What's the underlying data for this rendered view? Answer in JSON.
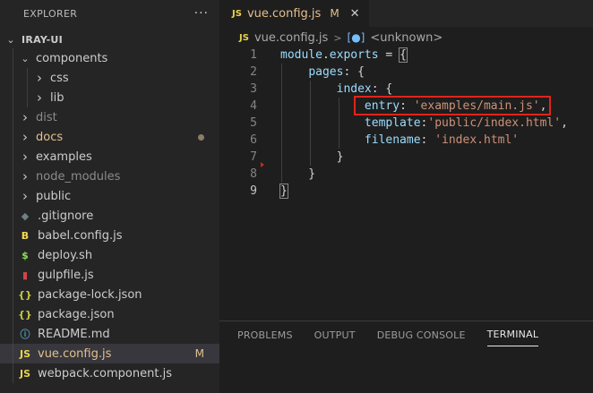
{
  "explorer": {
    "title": "EXPLORER",
    "more": "···",
    "root": "IRAY-UI",
    "items": [
      {
        "name": "components",
        "type": "folder",
        "open": true,
        "indent": 1,
        "style": "normal"
      },
      {
        "name": "css",
        "type": "folder",
        "open": false,
        "indent": 2,
        "style": "normal"
      },
      {
        "name": "lib",
        "type": "folder",
        "open": false,
        "indent": 2,
        "style": "normal"
      },
      {
        "name": "dist",
        "type": "folder",
        "open": false,
        "indent": 1,
        "style": "dim"
      },
      {
        "name": "docs",
        "type": "folder",
        "open": false,
        "indent": 1,
        "style": "mod",
        "dot": true
      },
      {
        "name": "examples",
        "type": "folder",
        "open": false,
        "indent": 1,
        "style": "normal"
      },
      {
        "name": "node_modules",
        "type": "folder",
        "open": false,
        "indent": 1,
        "style": "dim"
      },
      {
        "name": "public",
        "type": "folder",
        "open": false,
        "indent": 1,
        "style": "normal"
      },
      {
        "name": ".gitignore",
        "type": "file",
        "icon": "gitignore",
        "indent": 1,
        "style": "normal"
      },
      {
        "name": "babel.config.js",
        "type": "file",
        "icon": "babel",
        "indent": 1,
        "style": "normal"
      },
      {
        "name": "deploy.sh",
        "type": "file",
        "icon": "shell",
        "indent": 1,
        "style": "normal"
      },
      {
        "name": "gulpfile.js",
        "type": "file",
        "icon": "gulp",
        "indent": 1,
        "style": "normal"
      },
      {
        "name": "package-lock.json",
        "type": "file",
        "icon": "json",
        "indent": 1,
        "style": "normal"
      },
      {
        "name": "package.json",
        "type": "file",
        "icon": "json",
        "indent": 1,
        "style": "normal"
      },
      {
        "name": "README.md",
        "type": "file",
        "icon": "info",
        "indent": 1,
        "style": "normal"
      },
      {
        "name": "vue.config.js",
        "type": "file",
        "icon": "js",
        "indent": 1,
        "style": "mod",
        "badge": "M",
        "selected": true
      },
      {
        "name": "webpack.component.js",
        "type": "file",
        "icon": "js",
        "indent": 1,
        "style": "normal"
      }
    ]
  },
  "tab": {
    "badge": "JS",
    "name": "vue.config.js",
    "modified": "M",
    "close": "✕"
  },
  "breadcrumb": {
    "file_badge": "JS",
    "file": "vue.config.js",
    "symbol": "<unknown>"
  },
  "code": {
    "active_line": 9,
    "lines": [
      {
        "n": "1",
        "tokens": [
          [
            "prop",
            "module"
          ],
          [
            "punc",
            "."
          ],
          [
            "prop",
            "exports"
          ],
          [
            "punc",
            " = "
          ],
          [
            "brace",
            "{"
          ]
        ]
      },
      {
        "n": "2",
        "tokens": [
          [
            "punc",
            "    "
          ],
          [
            "prop",
            "pages"
          ],
          [
            "punc",
            ": {"
          ]
        ]
      },
      {
        "n": "3",
        "tokens": [
          [
            "punc",
            "        "
          ],
          [
            "prop",
            "index"
          ],
          [
            "punc",
            ": {"
          ]
        ]
      },
      {
        "n": "4",
        "tokens": [
          [
            "punc",
            "            "
          ],
          [
            "prop",
            "entry"
          ],
          [
            "punc",
            ": "
          ],
          [
            "str",
            "'examples/main.js'"
          ],
          [
            "punc",
            ","
          ]
        ]
      },
      {
        "n": "5",
        "tokens": [
          [
            "punc",
            "            "
          ],
          [
            "prop",
            "template"
          ],
          [
            "punc",
            ":"
          ],
          [
            "str",
            "'public/index.html'"
          ],
          [
            "punc",
            ","
          ]
        ]
      },
      {
        "n": "6",
        "tokens": [
          [
            "punc",
            "            "
          ],
          [
            "prop",
            "filename"
          ],
          [
            "punc",
            ": "
          ],
          [
            "str",
            "'index.html'"
          ]
        ]
      },
      {
        "n": "7",
        "tokens": [
          [
            "punc",
            "        }"
          ]
        ]
      },
      {
        "n": "8",
        "tokens": [
          [
            "punc",
            "    }"
          ]
        ]
      },
      {
        "n": "9",
        "tokens": [
          [
            "brace",
            "}"
          ]
        ]
      }
    ]
  },
  "panel": {
    "tabs": [
      {
        "label": "PROBLEMS",
        "active": false
      },
      {
        "label": "OUTPUT",
        "active": false
      },
      {
        "label": "DEBUG CONSOLE",
        "active": false
      },
      {
        "label": "TERMINAL",
        "active": true
      }
    ]
  },
  "colors": {
    "js_icon": "#e8d44d",
    "modified": "#e2c08d",
    "highlight_border": "#e2231a",
    "string": "#ce9178",
    "property": "#9cdcfe",
    "sidebar_bg": "#252526",
    "editor_bg": "#1e1e1e"
  }
}
